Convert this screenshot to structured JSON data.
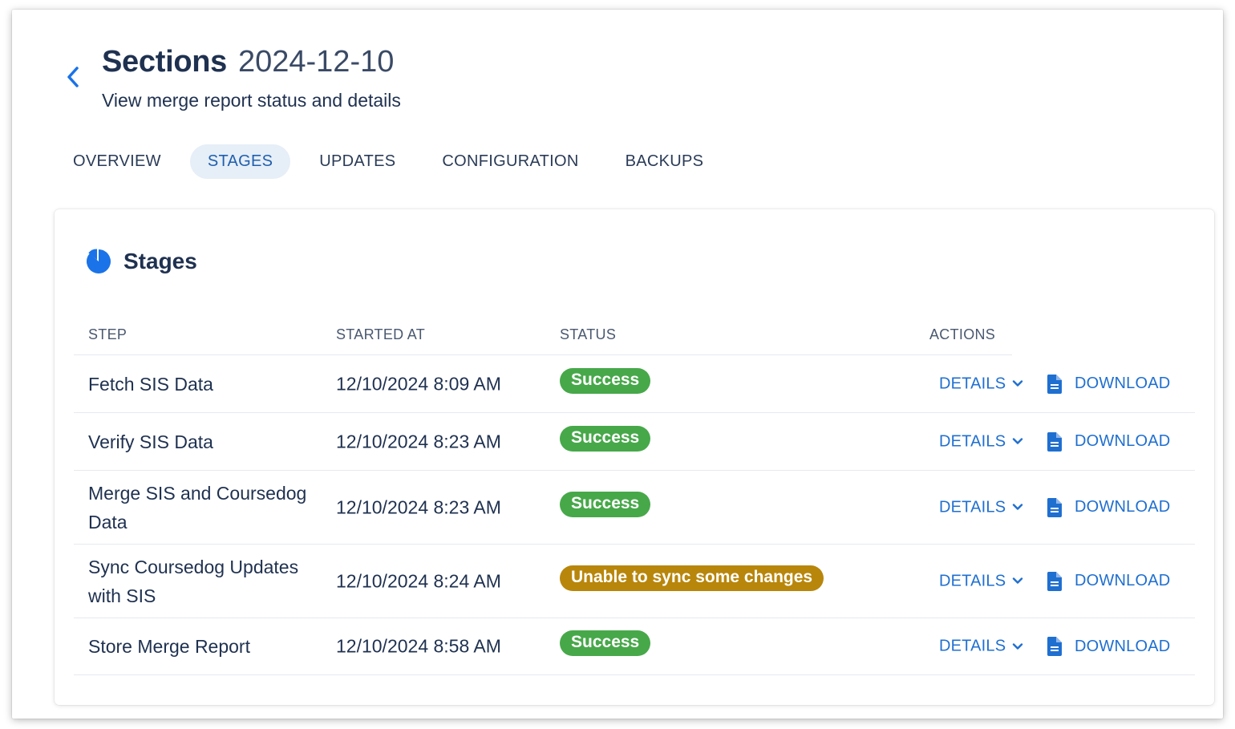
{
  "header": {
    "title": "Sections",
    "date": "2024-12-10",
    "subtitle": "View merge report status and details"
  },
  "tabs": [
    {
      "label": "OVERVIEW",
      "active": false
    },
    {
      "label": "STAGES",
      "active": true
    },
    {
      "label": "UPDATES",
      "active": false
    },
    {
      "label": "CONFIGURATION",
      "active": false
    },
    {
      "label": "BACKUPS",
      "active": false
    }
  ],
  "card": {
    "title": "Stages",
    "icon": "pie-chart-icon"
  },
  "table": {
    "columns": [
      "STEP",
      "STARTED AT",
      "STATUS",
      "ACTIONS"
    ],
    "details_label": "DETAILS",
    "download_label": "DOWNLOAD",
    "rows": [
      {
        "step": "Fetch SIS Data",
        "started_at": "12/10/2024 8:09 AM",
        "status": "Success",
        "status_type": "success"
      },
      {
        "step": "Verify SIS Data",
        "started_at": "12/10/2024 8:23 AM",
        "status": "Success",
        "status_type": "success"
      },
      {
        "step": "Merge SIS and Coursedog Data",
        "started_at": "12/10/2024 8:23 AM",
        "status": "Success",
        "status_type": "success"
      },
      {
        "step": "Sync Coursedog Updates with SIS",
        "started_at": "12/10/2024 8:24 AM",
        "status": "Unable to sync some changes",
        "status_type": "warning"
      },
      {
        "step": "Store Merge Report",
        "started_at": "12/10/2024 8:58 AM",
        "status": "Success",
        "status_type": "success"
      }
    ]
  },
  "colors": {
    "success": "#47a84a",
    "warning": "#b8860b",
    "link": "#1f6fd0",
    "accent": "#1a73e8",
    "title": "#1f3150"
  }
}
